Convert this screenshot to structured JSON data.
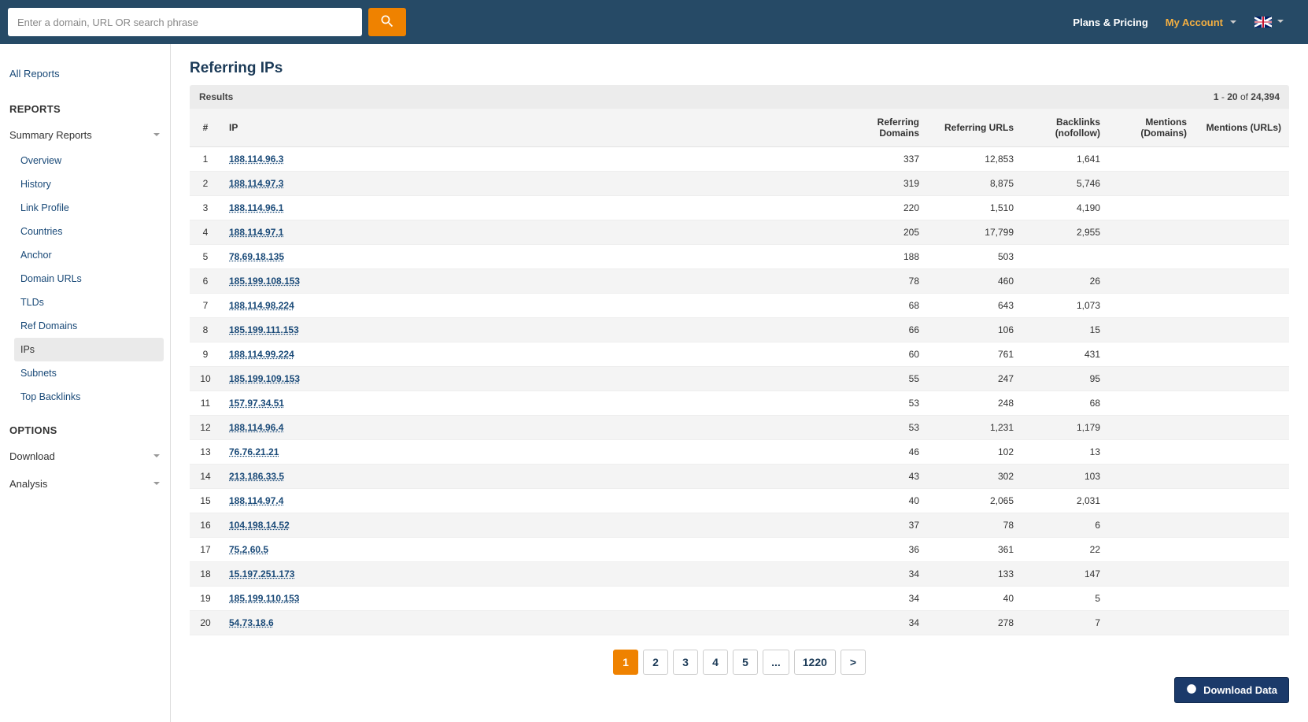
{
  "topbar": {
    "search_placeholder": "Enter a domain, URL OR search phrase",
    "plans_label": "Plans & Pricing",
    "account_label": "My Account",
    "locale": "en-GB"
  },
  "sidebar": {
    "all_reports_label": "All Reports",
    "reports_heading": "REPORTS",
    "summary_group_label": "Summary Reports",
    "summary_items": [
      {
        "label": "Overview"
      },
      {
        "label": "History"
      },
      {
        "label": "Link Profile"
      },
      {
        "label": "Countries"
      },
      {
        "label": "Anchor"
      },
      {
        "label": "Domain URLs"
      },
      {
        "label": "TLDs"
      },
      {
        "label": "Ref Domains"
      },
      {
        "label": "IPs"
      },
      {
        "label": "Subnets"
      },
      {
        "label": "Top Backlinks"
      }
    ],
    "active_index": 8,
    "options_heading": "OPTIONS",
    "download_group_label": "Download",
    "analysis_group_label": "Analysis"
  },
  "page": {
    "title": "Referring IPs",
    "results_label": "Results",
    "range_from": "1",
    "range_to": "20",
    "range_of_label": "of",
    "total": "24,394",
    "columns": {
      "idx": "#",
      "ip": "IP",
      "ref_domains": "Referring Domains",
      "ref_urls": "Referring URLs",
      "backlinks": "Backlinks (nofollow)",
      "mentions_domains": "Mentions (Domains)",
      "mentions_urls": "Mentions (URLs)"
    },
    "rows": [
      {
        "n": 1,
        "ip": "188.114.96.3",
        "rd": "337",
        "ru": "12,853",
        "bl": "1,641",
        "md": "",
        "mu": ""
      },
      {
        "n": 2,
        "ip": "188.114.97.3",
        "rd": "319",
        "ru": "8,875",
        "bl": "5,746",
        "md": "",
        "mu": ""
      },
      {
        "n": 3,
        "ip": "188.114.96.1",
        "rd": "220",
        "ru": "1,510",
        "bl": "4,190",
        "md": "",
        "mu": ""
      },
      {
        "n": 4,
        "ip": "188.114.97.1",
        "rd": "205",
        "ru": "17,799",
        "bl": "2,955",
        "md": "",
        "mu": ""
      },
      {
        "n": 5,
        "ip": "78.69.18.135",
        "rd": "188",
        "ru": "503",
        "bl": "",
        "md": "",
        "mu": ""
      },
      {
        "n": 6,
        "ip": "185.199.108.153",
        "rd": "78",
        "ru": "460",
        "bl": "26",
        "md": "",
        "mu": ""
      },
      {
        "n": 7,
        "ip": "188.114.98.224",
        "rd": "68",
        "ru": "643",
        "bl": "1,073",
        "md": "",
        "mu": ""
      },
      {
        "n": 8,
        "ip": "185.199.111.153",
        "rd": "66",
        "ru": "106",
        "bl": "15",
        "md": "",
        "mu": ""
      },
      {
        "n": 9,
        "ip": "188.114.99.224",
        "rd": "60",
        "ru": "761",
        "bl": "431",
        "md": "",
        "mu": ""
      },
      {
        "n": 10,
        "ip": "185.199.109.153",
        "rd": "55",
        "ru": "247",
        "bl": "95",
        "md": "",
        "mu": ""
      },
      {
        "n": 11,
        "ip": "157.97.34.51",
        "rd": "53",
        "ru": "248",
        "bl": "68",
        "md": "",
        "mu": ""
      },
      {
        "n": 12,
        "ip": "188.114.96.4",
        "rd": "53",
        "ru": "1,231",
        "bl": "1,179",
        "md": "",
        "mu": ""
      },
      {
        "n": 13,
        "ip": "76.76.21.21",
        "rd": "46",
        "ru": "102",
        "bl": "13",
        "md": "",
        "mu": ""
      },
      {
        "n": 14,
        "ip": "213.186.33.5",
        "rd": "43",
        "ru": "302",
        "bl": "103",
        "md": "",
        "mu": ""
      },
      {
        "n": 15,
        "ip": "188.114.97.4",
        "rd": "40",
        "ru": "2,065",
        "bl": "2,031",
        "md": "",
        "mu": ""
      },
      {
        "n": 16,
        "ip": "104.198.14.52",
        "rd": "37",
        "ru": "78",
        "bl": "6",
        "md": "",
        "mu": ""
      },
      {
        "n": 17,
        "ip": "75.2.60.5",
        "rd": "36",
        "ru": "361",
        "bl": "22",
        "md": "",
        "mu": ""
      },
      {
        "n": 18,
        "ip": "15.197.251.173",
        "rd": "34",
        "ru": "133",
        "bl": "147",
        "md": "",
        "mu": ""
      },
      {
        "n": 19,
        "ip": "185.199.110.153",
        "rd": "34",
        "ru": "40",
        "bl": "5",
        "md": "",
        "mu": ""
      },
      {
        "n": 20,
        "ip": "54.73.18.6",
        "rd": "34",
        "ru": "278",
        "bl": "7",
        "md": "",
        "mu": ""
      }
    ],
    "pagination": [
      "1",
      "2",
      "3",
      "4",
      "5",
      "...",
      "1220",
      ">"
    ],
    "pagination_active_index": 0,
    "download_label": "Download Data"
  }
}
